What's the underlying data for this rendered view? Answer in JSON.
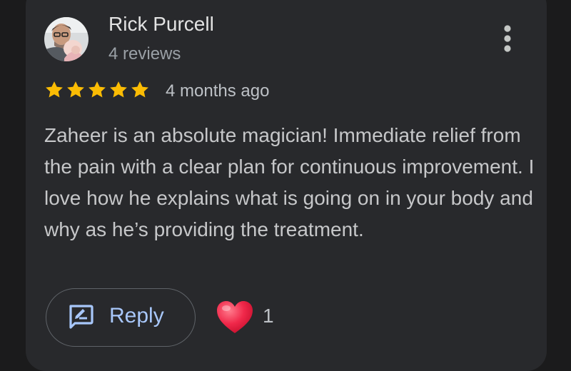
{
  "review": {
    "author": "Rick Purcell",
    "author_meta": "4 reviews",
    "rating": 5,
    "rating_max": 5,
    "date": "4 months ago",
    "text": "Zaheer is an absolute magician! Immediate relief from the pain with a clear plan for continuous improvement. I love how he explains what is going on in your body and why as he’s providing the treatment.",
    "reply_label": "Reply",
    "like_count": "1"
  },
  "colors": {
    "background": "#1b1b1c",
    "card": "#28292c",
    "star": "#fbbc04",
    "accent": "#a8c7fa",
    "heart": "#f0284a"
  },
  "icons": {
    "menu": "more-vert-icon",
    "reply": "rate-review-icon",
    "like": "heart-icon",
    "star": "star-icon"
  }
}
